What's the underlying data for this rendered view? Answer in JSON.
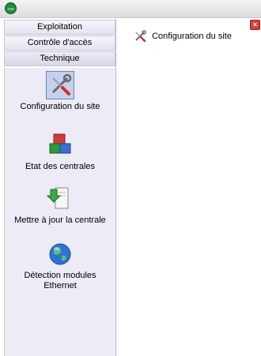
{
  "window": {
    "logo_text": "con",
    "close_glyph": "×"
  },
  "nav": {
    "buttons": [
      {
        "label": "Exploitation"
      },
      {
        "label": "Contrôle d'accès"
      },
      {
        "label": "Technique"
      }
    ]
  },
  "tools": [
    {
      "label": "Configuration du site",
      "icon": "tools-icon",
      "selected": true
    },
    {
      "label": "Etat des centrales",
      "icon": "cubes-icon",
      "selected": false
    },
    {
      "label": "Mettre à jour la centrale",
      "icon": "document-update-icon",
      "selected": false
    },
    {
      "label": "Détection modules Ethernet",
      "icon": "globe-icon",
      "selected": false
    }
  ],
  "main": {
    "open_item": "Configuration du site"
  },
  "colors": {
    "panel": "#ecebf6",
    "selected_bg": "#c5d1ea",
    "close_red": "#d8403a"
  }
}
